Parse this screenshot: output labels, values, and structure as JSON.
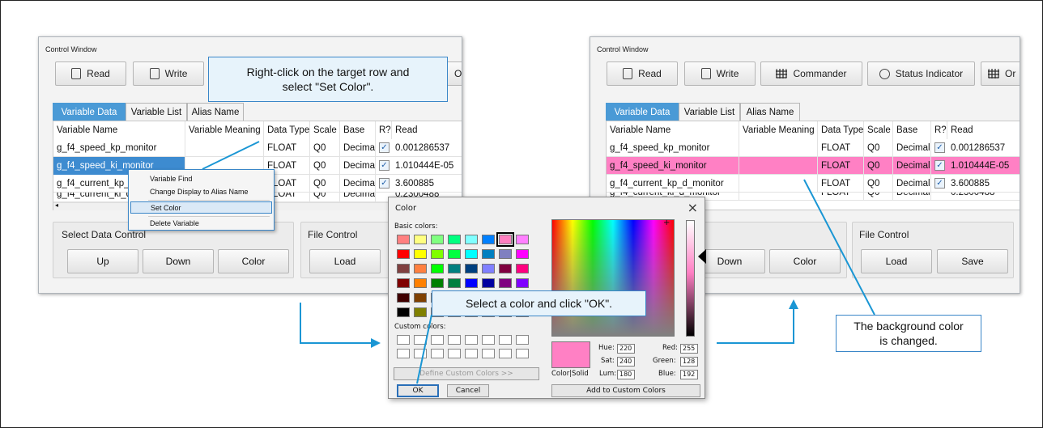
{
  "left": {
    "title": "Control Window",
    "toolbar": {
      "read": "Read",
      "write": "Write",
      "partial": "Or"
    },
    "tabs": [
      "Variable Data",
      "Variable List",
      "Alias Name"
    ],
    "columns": [
      "Variable Name",
      "Variable Meaning",
      "Data Type",
      "Scale",
      "Base",
      "R?",
      "Read"
    ],
    "rows": [
      {
        "name": "g_f4_speed_kp_monitor",
        "type": "FLOAT",
        "scale": "Q0",
        "base": "Decimal",
        "read": "0.001286537"
      },
      {
        "name": "g_f4_speed_ki_monitor",
        "type": "FLOAT",
        "scale": "Q0",
        "base": "Decimal",
        "read": "1.010444E-05"
      },
      {
        "name": "g_f4_current_kp_d_monitor",
        "type": "FLOAT",
        "scale": "Q0",
        "base": "Decimal",
        "read": "3.600885"
      },
      {
        "name": "g_f4_current_ki_d_monitor",
        "type": "FLOAT",
        "scale": "Q0",
        "base": "Decimal",
        "read": "0.2300488"
      }
    ],
    "select_group": {
      "label": "Select Data Control",
      "up": "Up",
      "down": "Down",
      "color": "Color"
    },
    "file_group": {
      "label": "File Control",
      "load": "Load"
    }
  },
  "context_menu": [
    "Variable Find",
    "Change Display to Alias Name",
    "Set Color",
    "Delete Variable"
  ],
  "callout_left": "Right-click on the target row and select \"Set Color\".",
  "callout_mid": "Select a color and click \"OK\".",
  "callout_right": "The background color is changed.",
  "right": {
    "title": "Control Window",
    "toolbar": {
      "read": "Read",
      "write": "Write",
      "commander": "Commander",
      "status": "Status Indicator",
      "partial": "Or"
    },
    "tabs": [
      "Variable Data",
      "Variable List",
      "Alias Name"
    ],
    "columns": [
      "Variable Name",
      "Variable Meaning",
      "Data Type",
      "Scale",
      "Base",
      "R?",
      "Read"
    ],
    "file_group": {
      "label": "File Control",
      "load": "Load",
      "save": "Save"
    },
    "buttons": {
      "down": "Down",
      "color": "Color"
    },
    "highlight_color": "#ff80c4"
  },
  "dialog": {
    "title": "Color",
    "basic_label": "Basic colors:",
    "custom_label": "Custom colors:",
    "define_btn": "Define Custom Colors >>",
    "ok": "OK",
    "cancel": "Cancel",
    "add_btn": "Add to Custom Colors",
    "color_solid": "Color|Solid",
    "hue_label": "Hue:",
    "hue": "220",
    "sat_label": "Sat:",
    "sat": "240",
    "lum_label": "Lum:",
    "lum": "180",
    "red_label": "Red:",
    "red": "255",
    "green_label": "Green:",
    "green": "128",
    "blue_label": "Blue:",
    "blue": "192",
    "close_glyph": "×",
    "basic_colors": [
      "#ff8080",
      "#ffff80",
      "#80ff80",
      "#00ff80",
      "#80ffff",
      "#0080ff",
      "#ff80c0",
      "#ff80ff",
      "#ff0000",
      "#ffff00",
      "#80ff00",
      "#00ff40",
      "#00ffff",
      "#0080c0",
      "#8080c0",
      "#ff00ff",
      "#804040",
      "#ff8040",
      "#00ff00",
      "#008080",
      "#004080",
      "#8080ff",
      "#800040",
      "#ff0080",
      "#800000",
      "#ff8000",
      "#008000",
      "#008040",
      "#0000ff",
      "#0000a0",
      "#800080",
      "#8000ff",
      "#400000",
      "#804000",
      "#004000",
      "#004040",
      "#000080",
      "#000040",
      "#400040",
      "#400080",
      "#000000",
      "#808000",
      "#808040",
      "#808080",
      "#408080",
      "#c0c0c0",
      "#400040",
      "#ffffff"
    ]
  }
}
